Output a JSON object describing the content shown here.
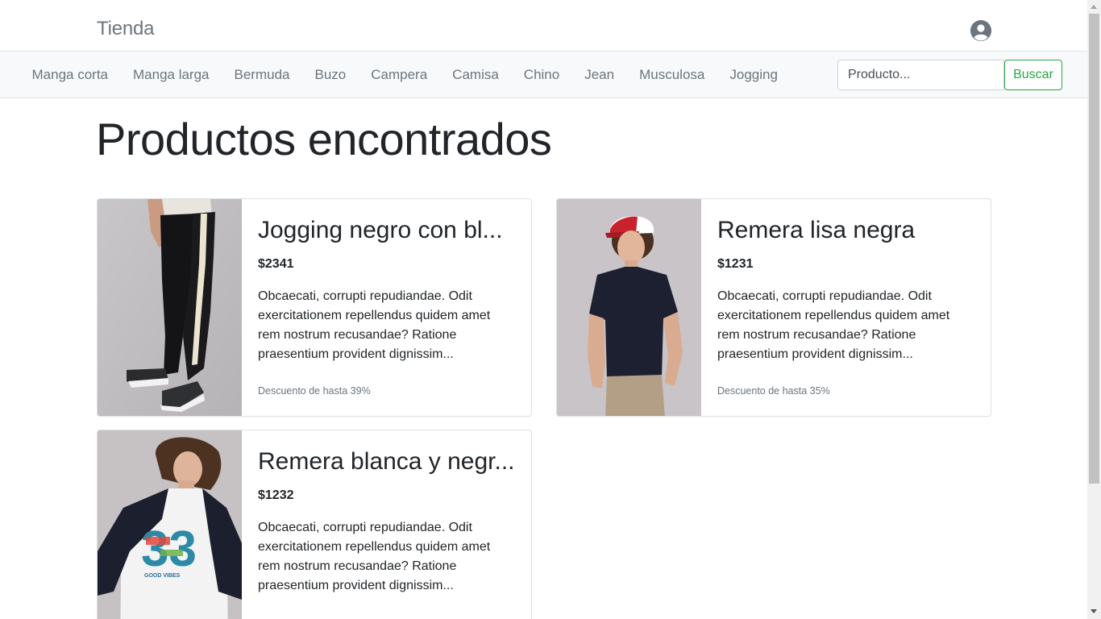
{
  "header": {
    "brand": "Tienda",
    "user_icon": "user-circle-icon"
  },
  "nav": {
    "categories": [
      "Manga corta",
      "Manga larga",
      "Bermuda",
      "Buzo",
      "Campera",
      "Camisa",
      "Chino",
      "Jean",
      "Musculosa",
      "Jogging"
    ]
  },
  "search": {
    "placeholder": "Producto...",
    "button_label": "Buscar"
  },
  "main": {
    "title": "Productos encontrados"
  },
  "products": [
    {
      "title": "Jogging negro con bl...",
      "price": "$2341",
      "description": "Obcaecati, corrupti repudiandae. Odit exercitationem repellendus quidem amet rem nostrum recusandae? Ratione praesentium provident dignissim...",
      "discount": "Descuento de hasta 39%",
      "image": "black-jogging-pants-photo"
    },
    {
      "title": "Remera lisa negra",
      "price": "$1231",
      "description": "Obcaecati, corrupti repudiandae. Odit exercitationem repellendus quidem amet rem nostrum recusandae? Ratione praesentium provident dignissim...",
      "discount": "Descuento de hasta 35%",
      "image": "black-tshirt-model-photo"
    },
    {
      "title": "Remera blanca y negr...",
      "price": "$1232",
      "description": "Obcaecati, corrupti repudiandae. Odit exercitationem repellendus quidem amet rem nostrum recusandae? Ratione praesentium provident dignissim...",
      "discount": "",
      "image": "white-black-raglan-tshirt-photo"
    }
  ],
  "colors": {
    "accent_green": "#28a745",
    "muted": "#6c757d",
    "nav_bg": "#f8f9fa"
  }
}
